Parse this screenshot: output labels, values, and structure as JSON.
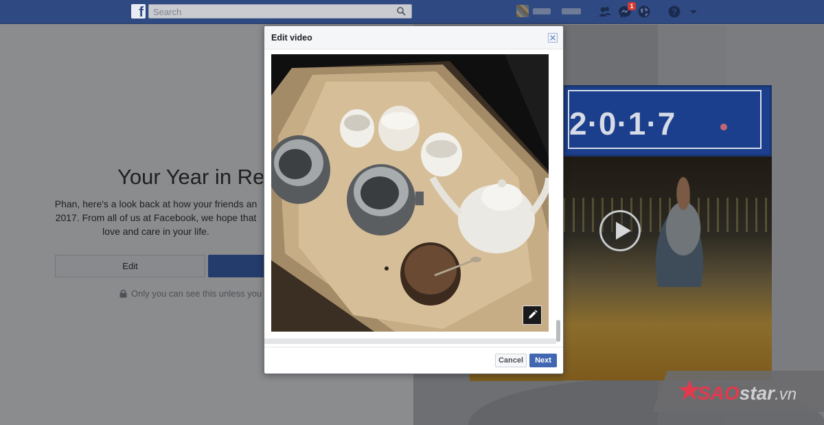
{
  "topbar": {
    "search_placeholder": "Search",
    "notification_count": "1"
  },
  "background": {
    "title": "Your Year in Rev",
    "description_lines": [
      "Phan, here's a look back at how your friends an",
      "2017. From all of us at Facebook, we hope that",
      "love and care in your life."
    ],
    "edit_label": "Edit",
    "privacy_text": "Only you can see this unless you"
  },
  "preview": {
    "year_text": "2·0·1·7"
  },
  "dialog": {
    "title": "Edit video",
    "cancel_label": "Cancel",
    "next_label": "Next"
  },
  "watermark": {
    "part1": "SAO",
    "part2": "star",
    "part3": ".vn"
  },
  "colors": {
    "topbar": "#2f4a82",
    "primary_button": "#4267b2",
    "banner_blue": "#1b3f8c"
  }
}
